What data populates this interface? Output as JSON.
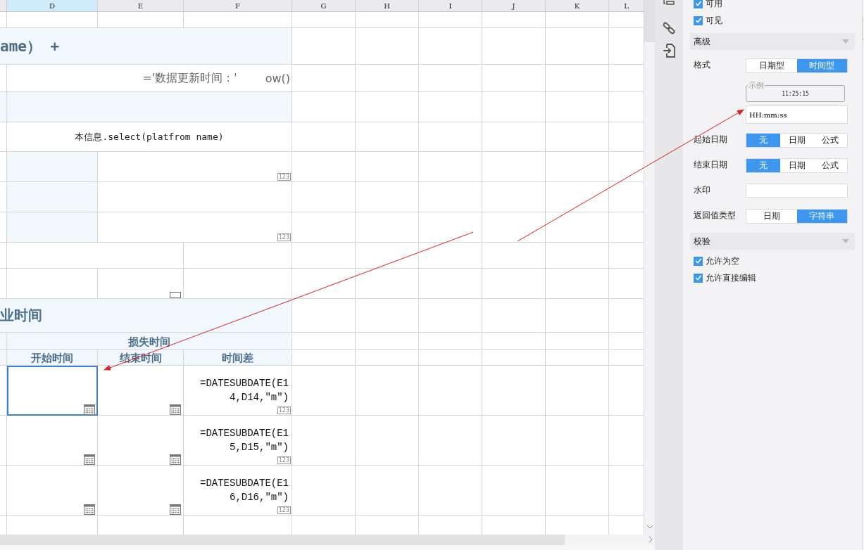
{
  "sheet": {
    "column_headers": [
      {
        "label": "D",
        "selected": true
      },
      {
        "label": "E",
        "selected": false
      },
      {
        "label": "F",
        "selected": false
      },
      {
        "label": "G",
        "selected": false
      },
      {
        "label": "H",
        "selected": false
      },
      {
        "label": "I",
        "selected": false
      },
      {
        "label": "J",
        "selected": false
      },
      {
        "label": "K",
        "selected": false
      },
      {
        "label": "L",
        "selected": false
      }
    ],
    "blocks": [
      {
        "kind": "spacer"
      },
      {
        "kind": "title",
        "text": "ame） +"
      },
      {
        "kind": "note",
        "text": "='数据更新时间：'",
        "text_end": "ow()"
      },
      {
        "kind": "subhead"
      },
      {
        "kind": "line",
        "text": "本信息.select(platfrom name)"
      },
      {
        "kind": "field",
        "badge": "123"
      },
      {
        "kind": "field"
      },
      {
        "kind": "field",
        "badge": "123"
      },
      {
        "kind": "gap"
      },
      {
        "kind": "spare"
      },
      {
        "kind": "section",
        "text": "业时间"
      },
      {
        "kind": "group",
        "text": "损失时间"
      },
      {
        "kind": "colhead",
        "labels": [
          "开始时间",
          "结束时间",
          "时间差"
        ]
      },
      {
        "kind": "entry",
        "start_time": {
          "selected": true
        },
        "end_time": {
          "selected": false
        },
        "time_diff": {
          "text": "=DATESUBDATE(E14,D14,\"m\")",
          "badge": "123",
          "selected": false
        }
      },
      {
        "kind": "entry",
        "start_time": {
          "selected": false
        },
        "end_time": {
          "selected": false
        },
        "time_diff": {
          "text": "=DATESUBDATE(E15,D15,\"m\")",
          "badge": "123",
          "selected": false
        }
      },
      {
        "kind": "entry",
        "start_time": {
          "selected": false
        },
        "end_time": {
          "selected": false
        },
        "time_diff": {
          "text": "=DATESUBDATE(E16,D16,\"m\")",
          "badge": "123",
          "selected": false
        }
      },
      {
        "kind": "cut"
      }
    ]
  },
  "panel": {
    "rows": [
      {
        "kind": "checkbox",
        "label": "可用",
        "checked": true
      },
      {
        "kind": "checkbox",
        "label": "可见",
        "checked": true
      },
      {
        "kind": "section",
        "label": "高级",
        "expanded": true
      },
      {
        "kind": "segmented",
        "label": "格式",
        "options": [
          {
            "label": "日期型",
            "selected": false
          },
          {
            "label": "时间型",
            "selected": true
          }
        ]
      },
      {
        "kind": "sample",
        "legend": "示例",
        "value": "11:25:15"
      },
      {
        "kind": "input",
        "value": "HH:mm:ss"
      },
      {
        "kind": "segmented",
        "label": "起始日期",
        "options": [
          {
            "label": "无",
            "selected": true
          },
          {
            "label": "日期",
            "selected": false
          },
          {
            "label": "公式",
            "selected": false
          }
        ]
      },
      {
        "kind": "segmented",
        "label": "结束日期",
        "options": [
          {
            "label": "无",
            "selected": true
          },
          {
            "label": "日期",
            "selected": false
          },
          {
            "label": "公式",
            "selected": false
          }
        ]
      },
      {
        "kind": "input",
        "label": "水印"
      },
      {
        "kind": "segmented",
        "label": "返回值类型",
        "options": [
          {
            "label": "日期",
            "selected": false
          },
          {
            "label": "字符串",
            "selected": true
          }
        ]
      },
      {
        "kind": "section",
        "label": "校验",
        "expanded": true
      },
      {
        "kind": "checkbox",
        "label": "允许为空",
        "checked": true
      },
      {
        "kind": "checkbox",
        "label": "允许直接编辑",
        "checked": true
      }
    ]
  }
}
